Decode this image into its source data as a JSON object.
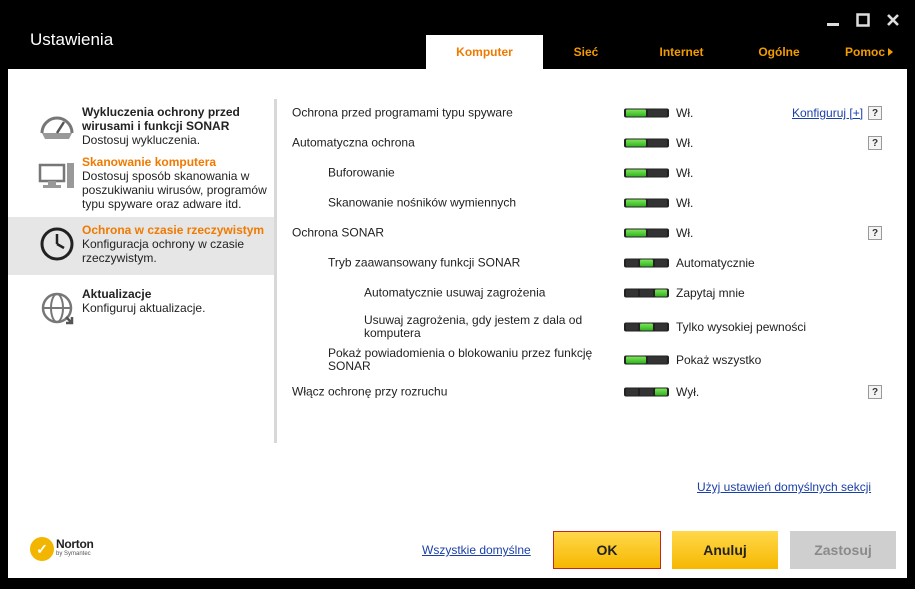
{
  "window": {
    "title": "Ustawienia",
    "controls": [
      "minimize-icon",
      "maximize-icon",
      "close-icon"
    ]
  },
  "tabs": [
    {
      "label": "Komputer",
      "active": true
    },
    {
      "label": "Sieć",
      "active": false
    },
    {
      "label": "Internet",
      "active": false
    },
    {
      "label": "Ogólne",
      "active": false
    },
    {
      "label": "Pomoc",
      "active": false,
      "icon": "play-arrow-icon"
    }
  ],
  "sidebar": {
    "items": [
      {
        "icon": "gauge-icon",
        "title": "Wykluczenia ochrony przed wirusami i funkcji SONAR",
        "desc": "Dostosuj wykluczenia."
      },
      {
        "icon": "computer-icon",
        "title": "Skanowanie komputera",
        "desc": "Dostosuj sposób skanowania w poszukiwaniu wirusów, programów typu spyware oraz adware itd."
      },
      {
        "icon": "clock-icon",
        "title": "Ochrona w czasie rzeczywistym",
        "desc": "Konfiguracja ochrony w czasie rzeczywistym.",
        "active": true
      },
      {
        "icon": "globe-update-icon",
        "title": "Aktualizacje",
        "desc": "Konfiguruj aktualizacje."
      }
    ]
  },
  "settings": [
    {
      "label": "Ochrona przed programami typu spyware",
      "toggle": "on",
      "value": "Wł.",
      "config": "Konfiguruj [+]",
      "help": "?"
    },
    {
      "label": "Automatyczna ochrona",
      "toggle": "on",
      "value": "Wł.",
      "help": "?"
    },
    {
      "label": "Buforowanie",
      "toggle": "on",
      "value": "Wł."
    },
    {
      "label": "Skanowanie nośników wymiennych",
      "toggle": "on",
      "value": "Wł."
    },
    {
      "label": "Ochrona SONAR",
      "toggle": "on",
      "value": "Wł.",
      "help": "?"
    },
    {
      "label": "Tryb zaawansowany funkcji SONAR",
      "toggle": "middle",
      "value": "Automatycznie"
    },
    {
      "label": "Automatycznie usuwaj zagrożenia",
      "toggle": "right",
      "value": "Zapytaj mnie"
    },
    {
      "label": "Usuwaj zagrożenia, gdy jestem z dala od komputera",
      "toggle": "middle",
      "value": "Tylko wysokiej pewności"
    },
    {
      "label": "Pokaż powiadomienia o blokowaniu przez funkcję SONAR",
      "toggle": "on",
      "value": "Pokaż wszystko"
    },
    {
      "label": "Włącz ochronę przy rozruchu",
      "toggle": "right",
      "value": "Wył.",
      "help": "?"
    }
  ],
  "section_defaults_link": "Użyj ustawień domyślnych sekcji",
  "footer": {
    "logo_name": "Norton",
    "logo_sub": "by Symantec",
    "all_defaults_link": "Wszystkie domyślne",
    "ok": "OK",
    "cancel": "Anuluj",
    "apply": "Zastosuj"
  },
  "colors": {
    "accent_orange": "#f07a00",
    "toggle_green": "#3fc72a",
    "button_yellow": "#f6b800",
    "link_blue": "#1a3fa8"
  }
}
